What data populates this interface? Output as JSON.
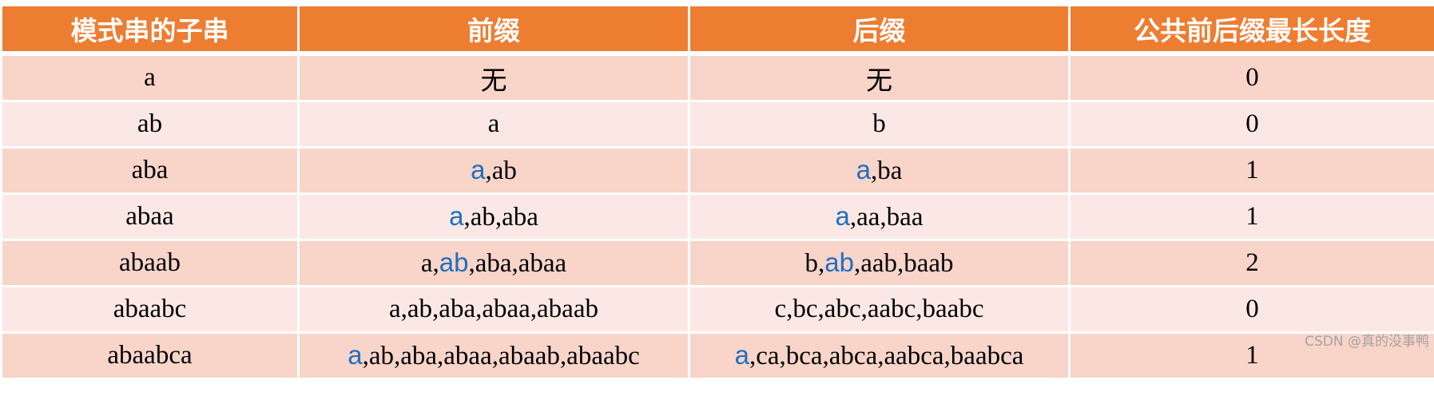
{
  "table": {
    "headers": [
      "模式串的子串",
      "前缀",
      "后缀",
      "公共前后缀最长长度"
    ],
    "highlight_color": "#1f6fc0",
    "header_color": "#ed7d31",
    "row_colors": [
      "#f8d4c9",
      "#fbe8e4"
    ],
    "rows": [
      {
        "substring": "a",
        "prefix": [
          {
            "t": "无",
            "hl": false
          }
        ],
        "suffix": [
          {
            "t": "无",
            "hl": false
          }
        ],
        "length": "0"
      },
      {
        "substring": "ab",
        "prefix": [
          {
            "t": "a",
            "hl": false
          }
        ],
        "suffix": [
          {
            "t": "b",
            "hl": false
          }
        ],
        "length": "0"
      },
      {
        "substring": "aba",
        "prefix": [
          {
            "t": "a",
            "hl": true
          },
          {
            "t": ",ab",
            "hl": false
          }
        ],
        "suffix": [
          {
            "t": "a",
            "hl": true
          },
          {
            "t": ",ba",
            "hl": false
          }
        ],
        "length": "1"
      },
      {
        "substring": "abaa",
        "prefix": [
          {
            "t": "a",
            "hl": true
          },
          {
            "t": ",ab,aba",
            "hl": false
          }
        ],
        "suffix": [
          {
            "t": "a",
            "hl": true
          },
          {
            "t": ",aa,baa",
            "hl": false
          }
        ],
        "length": "1"
      },
      {
        "substring": "abaab",
        "prefix": [
          {
            "t": "a,",
            "hl": false
          },
          {
            "t": "ab",
            "hl": true
          },
          {
            "t": ",aba,abaa",
            "hl": false
          }
        ],
        "suffix": [
          {
            "t": "b,",
            "hl": false
          },
          {
            "t": "ab",
            "hl": true
          },
          {
            "t": ",aab,baab",
            "hl": false
          }
        ],
        "length": "2"
      },
      {
        "substring": "abaabc",
        "prefix": [
          {
            "t": "a,ab,aba,abaa,abaab",
            "hl": false
          }
        ],
        "suffix": [
          {
            "t": "c,bc,abc,aabc,baabc",
            "hl": false
          }
        ],
        "length": "0"
      },
      {
        "substring": "abaabca",
        "prefix": [
          {
            "t": "a",
            "hl": true
          },
          {
            "t": ",ab,aba,abaa,abaab,abaabc",
            "hl": false
          }
        ],
        "suffix": [
          {
            "t": "a",
            "hl": true
          },
          {
            "t": ",ca,bca,abca,aabca,baabca",
            "hl": false
          }
        ],
        "length": "1"
      }
    ]
  },
  "watermark": "CSDN @真的没事鸭"
}
